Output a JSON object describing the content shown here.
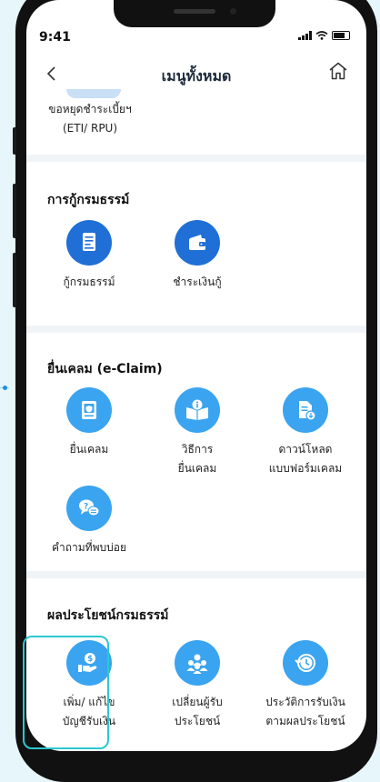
{
  "status": {
    "time": "9:41"
  },
  "header": {
    "title": "เมนูทั้งหมด"
  },
  "partial_item": {
    "label_line1": "ขอหยุดชำระเบี้ยฯ",
    "label_line2": "(ETI/ RPU)"
  },
  "sections": {
    "loan": {
      "title": "การกู้กรมธรรม์",
      "items": [
        {
          "label": "กู้กรมธรรม์",
          "icon": "loan-document-icon"
        },
        {
          "label": "ชำระเงินกู้",
          "icon": "wallet-icon"
        }
      ]
    },
    "claim": {
      "title": "ยื่นเคลม (e-Claim)",
      "items": [
        {
          "label": "ยื่นเคลม",
          "icon": "claim-form-icon"
        },
        {
          "label_line1": "วิธีการ",
          "label_line2": "ยื่นเคลม",
          "icon": "info-book-icon"
        },
        {
          "label_line1": "ดาวน์โหลด",
          "label_line2": "แบบฟอร์มเคลม",
          "icon": "download-form-icon"
        },
        {
          "label": "คำถามที่พบบ่อย",
          "icon": "faq-chat-icon"
        }
      ]
    },
    "benefit": {
      "title": "ผลประโยชน์กรมธรรม์",
      "items": [
        {
          "label_line1": "เพิ่ม/ แก้ไข",
          "label_line2": "บัญชีรับเงิน",
          "icon": "money-hand-icon"
        },
        {
          "label_line1": "เปลี่ยนผู้รับ",
          "label_line2": "ประโยชน์",
          "icon": "beneficiary-group-icon"
        },
        {
          "label_line1": "ประวัติการรับเงิน",
          "label_line2": "ตามผลประโยชน์",
          "icon": "history-clock-icon"
        }
      ]
    }
  },
  "colors": {
    "primary_blue": "#1f6fd6",
    "light_blue": "#3aa4f0",
    "selection": "#2cc8d0",
    "section_bg": "#f1f4f7"
  }
}
